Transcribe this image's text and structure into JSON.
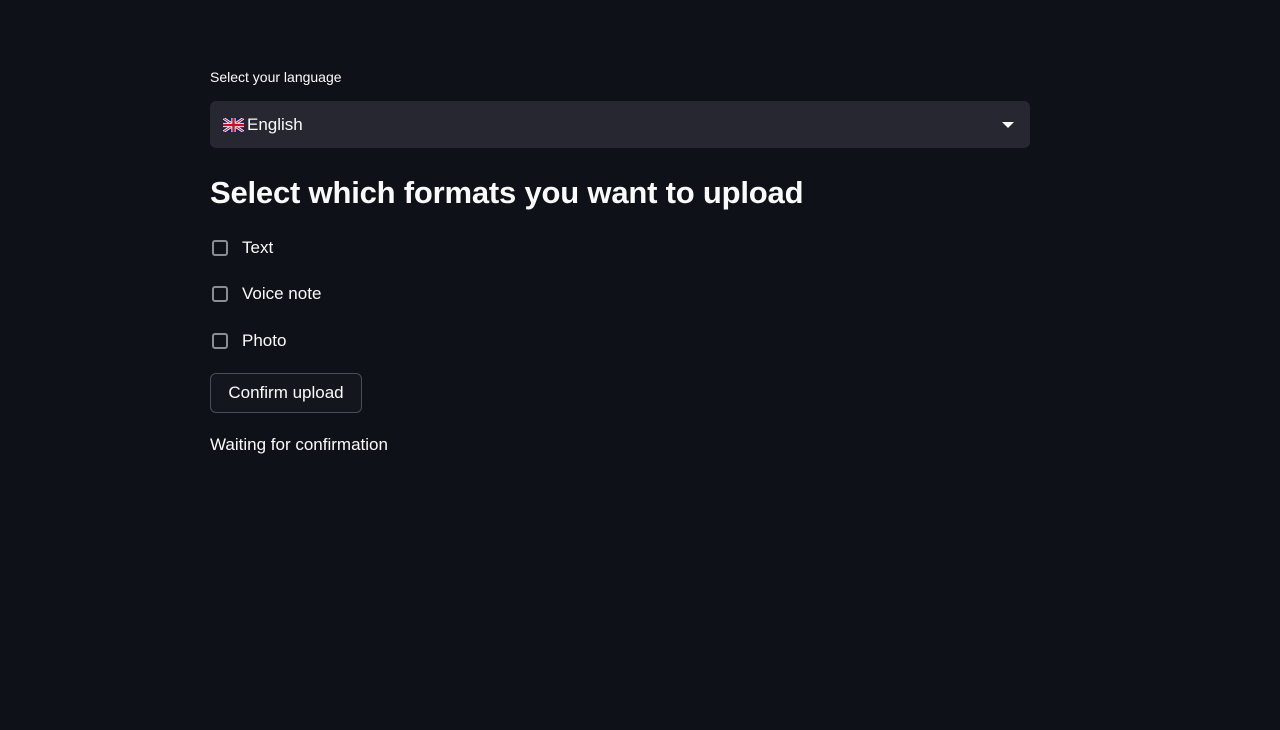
{
  "language": {
    "label": "Select your language",
    "selected_flag_icon": "uk-flag-icon",
    "selected_value": "English"
  },
  "formats": {
    "heading": "Select which formats you want to upload",
    "options": [
      {
        "label": "Text",
        "checked": false
      },
      {
        "label": "Voice note",
        "checked": false
      },
      {
        "label": "Photo",
        "checked": false
      }
    ]
  },
  "confirm_button": {
    "label": "Confirm upload"
  },
  "status": {
    "text": "Waiting for confirmation"
  },
  "colors": {
    "background": "#0e1117",
    "select_background": "#262730",
    "text": "#fafafa",
    "checkbox_border": "#8b8d94"
  }
}
